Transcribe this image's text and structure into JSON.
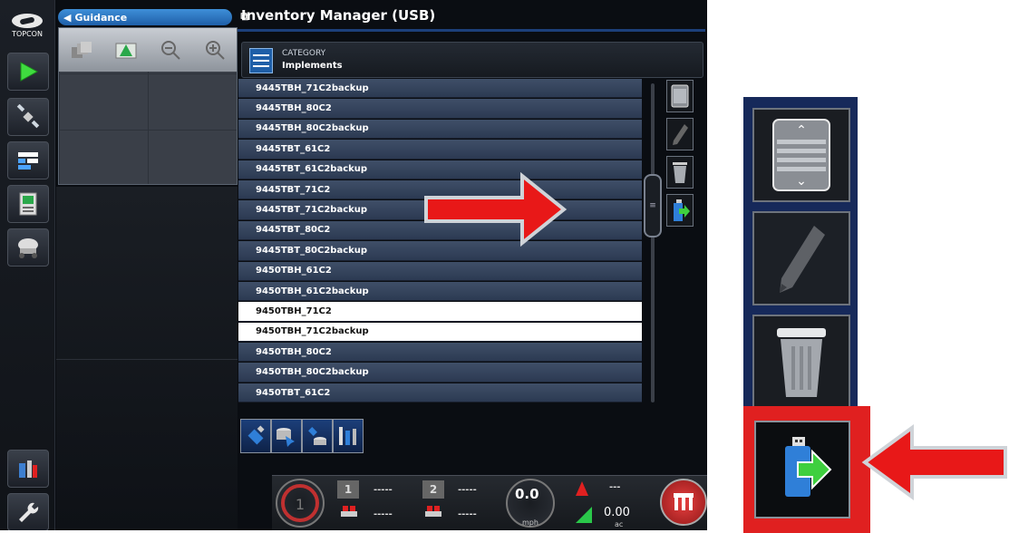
{
  "logo": {
    "text": "TOPCON"
  },
  "left_rail": {
    "icons": [
      "play-icon",
      "satellite-icon",
      "layout-icon",
      "console-icon",
      "vehicle-icon",
      "file-manager-icon",
      "wrench-icon"
    ]
  },
  "guidance": {
    "label": "Guidance",
    "tools": [
      "view-3d-icon",
      "field-view-icon",
      "zoom-out-icon",
      "zoom-in-icon"
    ]
  },
  "main": {
    "title": "Inventory Manager (USB)",
    "category": {
      "label": "CATEGORY",
      "value": "Implements"
    },
    "items": [
      "9445TBH_71C2backup",
      "9445TBH_80C2",
      "9445TBH_80C2backup",
      "9445TBT_61C2",
      "9445TBT_61C2backup",
      "9445TBT_71C2",
      "9445TBT_71C2backup",
      "9445TBT_80C2",
      "9445TBT_80C2backup",
      "9450TBH_61C2",
      "9450TBH_61C2backup",
      "9450TBH_71C2",
      "9450TBH_71C2backup",
      "9450TBH_80C2",
      "9450TBH_80C2backup",
      "9450TBT_61C2"
    ],
    "selected_items": [
      "9450TBH_71C2",
      "9450TBH_71C2backup"
    ],
    "side_buttons": [
      "select-all-icon",
      "edit-icon",
      "delete-icon",
      "export-to-usb-icon"
    ],
    "bottom_buttons": [
      "usb-icon",
      "copy-to-database-icon",
      "transfer-icon",
      "tools-icon"
    ]
  },
  "status": {
    "section1": "1",
    "section2": "2",
    "dashes": "-----",
    "speed": "0.0",
    "speed_unit": "mph",
    "top_right": "---",
    "area": "0.00",
    "area_unit": "ac"
  },
  "zoom_panel": {
    "buttons": [
      "select-all-icon",
      "edit-icon",
      "delete-icon",
      "export-to-usb-icon"
    ],
    "highlighted": "export-to-usb-icon"
  },
  "colors": {
    "highlight": "#e02020",
    "accent": "#1f5fa8",
    "row": "#34435c",
    "selected_row": "#ffffff"
  }
}
